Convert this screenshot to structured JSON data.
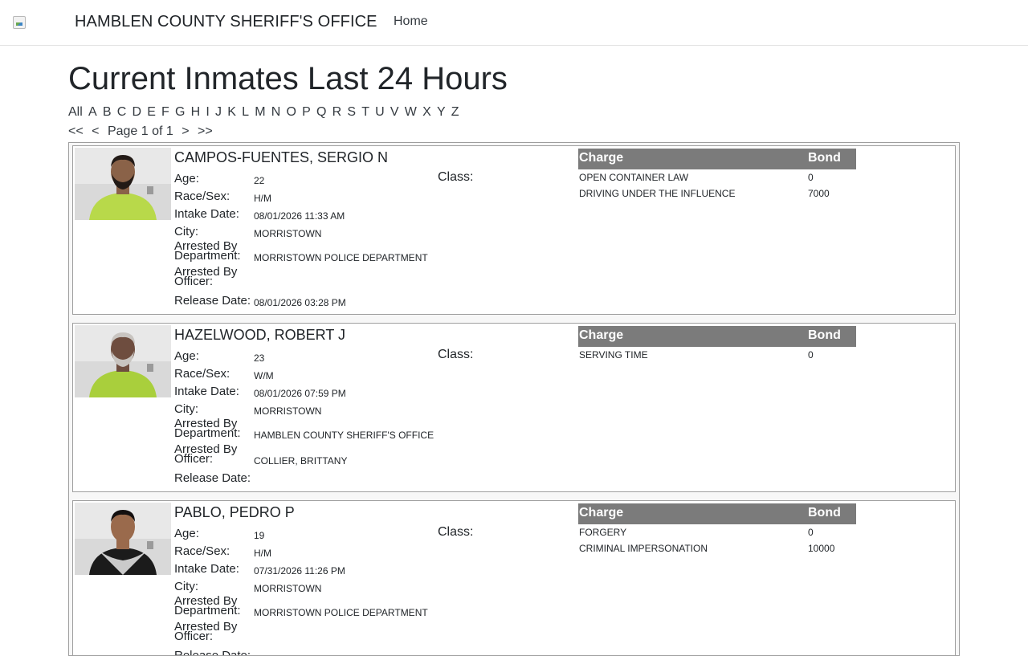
{
  "navbar": {
    "brand": "HAMBLEN COUNTY SHERIFF'S OFFICE",
    "home_label": "Home",
    "logo_icon": "broken-image-icon"
  },
  "page": {
    "title": "Current Inmates Last 24 Hours",
    "letters": [
      "All",
      "A",
      "B",
      "C",
      "D",
      "E",
      "F",
      "G",
      "H",
      "I",
      "J",
      "K",
      "L",
      "M",
      "N",
      "O",
      "P",
      "Q",
      "R",
      "S",
      "T",
      "U",
      "V",
      "W",
      "X",
      "Y",
      "Z"
    ],
    "pager": {
      "first": "<<",
      "prev": "<",
      "status": "Page 1 of 1",
      "next": ">",
      "last": ">>"
    }
  },
  "labels": {
    "age": "Age:",
    "class": "Class:",
    "race_sex": "Race/Sex:",
    "intake": "Intake Date:",
    "city": "City:",
    "arrested_dept": [
      "Arrested By",
      "Department:"
    ],
    "arrested_officer": [
      "Arrested By",
      "Officer:"
    ],
    "release": "Release Date:",
    "charge_col": "Charge",
    "bond_col": "Bond"
  },
  "inmates": [
    {
      "name": "CAMPOS-FUENTES, SERGIO N",
      "age": "22",
      "class": "",
      "race_sex": "H/M",
      "intake_date": "08/01/2026 11:33 AM",
      "city": "MORRISTOWN",
      "department": "MORRISTOWN POLICE DEPARTMENT",
      "officer": "",
      "release_date": "08/01/2026 03:28 PM",
      "charges": [
        {
          "charge": "OPEN CONTAINER LAW",
          "bond": "0"
        },
        {
          "charge": "DRIVING UNDER THE INFLUENCE",
          "bond": "7000"
        }
      ],
      "photo": {
        "shirt": "#b8d94a",
        "skin": "#8a6248",
        "hair": "#221a16",
        "beard": true
      }
    },
    {
      "name": "HAZELWOOD, ROBERT J",
      "age": "23",
      "class": "",
      "race_sex": "W/M",
      "intake_date": "08/01/2026 07:59 PM",
      "city": "MORRISTOWN",
      "department": "HAMBLEN COUNTY SHERIFF'S OFFICE",
      "officer": "COLLIER, BRITTANY",
      "release_date": "",
      "charges": [
        {
          "charge": "SERVING TIME",
          "bond": "0"
        }
      ],
      "photo": {
        "shirt": "#a9cf3c",
        "skin": "#6e4d3f",
        "hair": "#c8c4c0",
        "beard": true
      }
    },
    {
      "name": "PABLO, PEDRO P",
      "age": "19",
      "class": "",
      "race_sex": "H/M",
      "intake_date": "07/31/2026 11:26 PM",
      "city": "MORRISTOWN",
      "department": "MORRISTOWN POLICE DEPARTMENT",
      "officer": "",
      "release_date": "",
      "charges": [
        {
          "charge": "FORGERY",
          "bond": "0"
        },
        {
          "charge": "CRIMINAL IMPERSONATION",
          "bond": "10000"
        }
      ],
      "photo": {
        "shirt": "#1b1b1b",
        "skin": "#9a6a4c",
        "hair": "#141010",
        "beard": false
      }
    }
  ]
}
